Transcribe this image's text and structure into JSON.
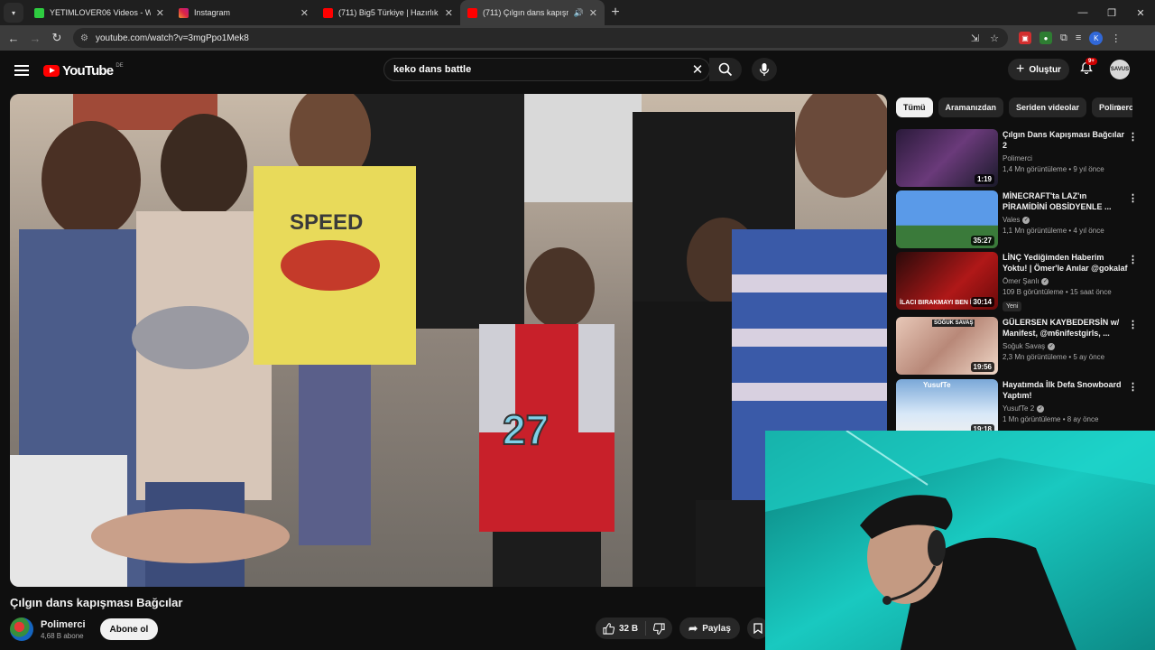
{
  "tabs": [
    {
      "title": "YETIMLOVER06 Videos - Watch",
      "favicon_color": "#2ecc40",
      "active": false
    },
    {
      "title": "Instagram",
      "favicon_color": "#d6249f",
      "active": false
    },
    {
      "title": "(711) Big5 Türkiye | Hazırlık Se...",
      "favicon_color": "#ff0000",
      "active": false
    },
    {
      "title": "(711) Çılgın dans kapışması",
      "favicon_color": "#ff0000",
      "active": true
    }
  ],
  "address_bar": {
    "url": "youtube.com/watch?v=3mgPpo1Mek8"
  },
  "browser": {
    "profile_initial": "K"
  },
  "header": {
    "logo_text": "YouTube",
    "region": "DE",
    "search_query": "keko dans battle",
    "create_label": "Oluştur",
    "notification_count": "9+",
    "avatar_text": "SAVUS"
  },
  "video": {
    "title": "Çılgın dans kapışması Bağcılar",
    "channel": "Polimerci",
    "subscribers": "4,68 B abone",
    "subscribe_label": "Abone ol",
    "likes": "32 B",
    "share_label": "Paylaş",
    "jersey_number": "27",
    "shirt_text": "SPEED"
  },
  "sidebar": {
    "chips": [
      "Tümü",
      "Aramanızdan",
      "Seriden videolar",
      "Polimerci"
    ],
    "recommendations": [
      {
        "title": "Çılgın Dans Kapışması Bağcılar 2",
        "channel": "Polimerci",
        "verified": false,
        "meta": "1,4 Mn görüntüleme • 9 yıl önce",
        "duration": "1:19",
        "badge": "",
        "thumb_color": "#3a2a4a"
      },
      {
        "title": "MİNECRAFT'ta LAZ'ın PİRAMİDİNİ OBSİDYENLE ...",
        "channel": "Vales",
        "verified": true,
        "meta": "1,1 Mn görüntüleme • 4 yıl önce",
        "duration": "35:27",
        "badge": "",
        "thumb_color": "#4a8ad8"
      },
      {
        "title": "LİNÇ Yediğimden Haberim Yoktu! | Ömer'le Anılar @gokalaf",
        "channel": "Ömer Şanlı",
        "verified": true,
        "meta": "109 B görüntüleme • 15 saat önce",
        "duration": "30:14",
        "badge": "Yeni",
        "thumb_color": "#b01818",
        "thumb_caption": "İLACI BIRAKMAYI BEN İS"
      },
      {
        "title": "GÜLERSEN KAYBEDERSİN w/ Manifest, @m6nifestgirls, ...",
        "channel": "Soğuk Savaş",
        "verified": true,
        "meta": "2,3 Mn görüntüleme • 5 ay önce",
        "duration": "19:56",
        "badge": "",
        "thumb_color": "#c8a08a",
        "thumb_caption": "SOĞUK SAVAŞ"
      },
      {
        "title": "Hayatımda İlk Defa Snowboard Yaptım!",
        "channel": "YusufTe 2",
        "verified": true,
        "meta": "1 Mn görüntüleme • 8 ay önce",
        "duration": "19:18",
        "badge": "",
        "thumb_color": "#9ab8d8",
        "thumb_caption": "YusufTe"
      }
    ]
  },
  "colors": {
    "accent": "#ff0000",
    "background": "#0f0f0f",
    "chip": "#272727",
    "webcam_bg": "#19c9c0"
  }
}
